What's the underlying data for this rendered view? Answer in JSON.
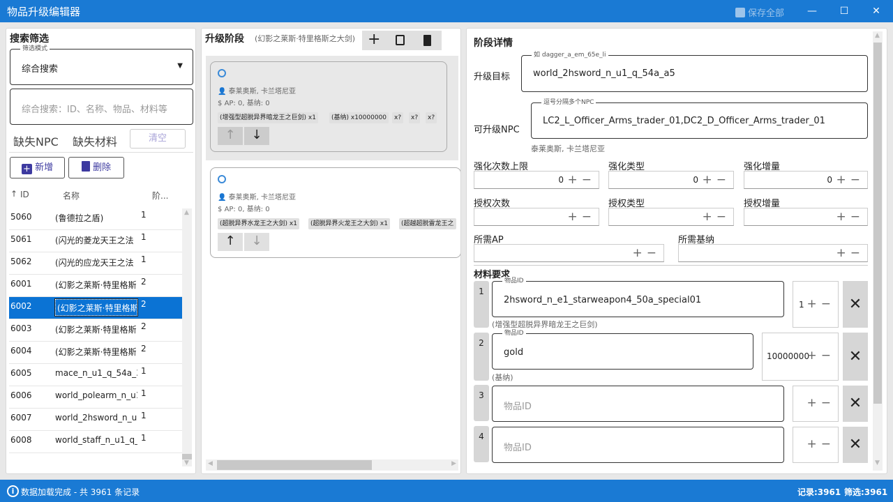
{
  "window": {
    "title": "物品升级编辑器",
    "save_all": "保存全部",
    "min": "—",
    "max": "☐",
    "close": "✕"
  },
  "left": {
    "title": "搜索筛选",
    "mode_legend": "筛选模式",
    "mode_value": "综合搜索",
    "search_placeholder": "综合搜索：ID、名称、物品、材料等",
    "missing_npc": "缺失NPC",
    "missing_material": "缺失材料",
    "clear": "清空",
    "add": "新增",
    "delete": "删除",
    "columns": {
      "id": "ID",
      "name": "名称",
      "stage": "阶..."
    },
    "rows": [
      {
        "id": "5060",
        "name": "(鲁德拉之盾)",
        "stage": "1"
      },
      {
        "id": "5061",
        "name": "(闪光的菱龙天王之法",
        "stage": "1"
      },
      {
        "id": "5062",
        "name": "(闪光的应龙天王之法",
        "stage": "1"
      },
      {
        "id": "6001",
        "name": "(幻影之莱斯·特里格斯",
        "stage": "2"
      },
      {
        "id": "6002",
        "name": "(幻影之莱斯·特里格斯",
        "stage": "2"
      },
      {
        "id": "6003",
        "name": "(幻影之莱斯·特里格斯",
        "stage": "2"
      },
      {
        "id": "6004",
        "name": "(幻影之莱斯·特里格斯",
        "stage": "2"
      },
      {
        "id": "6005",
        "name": "mace_n_u1_q_54a_3",
        "stage": "1"
      },
      {
        "id": "6006",
        "name": "world_polearm_n_u1",
        "stage": "1"
      },
      {
        "id": "6007",
        "name": "world_2hsword_n_u1",
        "stage": "1"
      },
      {
        "id": "6008",
        "name": "world_staff_n_u1_q_5",
        "stage": "1"
      }
    ]
  },
  "mid": {
    "title": "升级阶段",
    "subtitle": "(幻影之莱斯·特里格斯之大剑)",
    "stages": [
      {
        "npc": "泰莱奥斯, 卡兰塔尼亚",
        "ap": "AP: 0,  基纳: 0",
        "chips": [
          "(增强型超脱异界暗龙王之巨剑) x1",
          "(基纳) x10000000",
          "x?",
          "x?",
          "x?"
        ]
      },
      {
        "npc": "泰莱奥斯, 卡兰塔尼亚",
        "ap": "AP: 0,  基纳: 0",
        "chips": [
          "(超脱异界水龙王之大剑) x1",
          "(超脱异界火龙王之大剑) x1",
          "(超越超脱雷龙王之"
        ]
      }
    ]
  },
  "right": {
    "title": "阶段详情",
    "target_label": "升级目标",
    "target_legend": "如 dagger_a_em_65e_li",
    "target_value": "world_2hsword_n_u1_q_54a_a5",
    "npc_label": "可升级NPC",
    "npc_legend": "逗号分隔多个NPC",
    "npc_value": "LC2_L_Officer_Arms_trader_01,DC2_D_Officer_Arms_trader_01",
    "npc_names": "泰莱奥斯, 卡兰塔尼亚",
    "f_enh_max": "强化次数上限",
    "v_enh_max": "0",
    "f_enh_type": "强化类型",
    "v_enh_type": "0",
    "f_enh_inc": "强化增量",
    "v_enh_inc": "0",
    "f_auth": "授权次数",
    "f_auth_type": "授权类型",
    "f_auth_inc": "授权增量",
    "f_ap": "所需AP",
    "f_kinah": "所需基纳",
    "materials_title": "材料要求",
    "item_legend": "物品ID",
    "item_placeholder": "物品ID",
    "materials": [
      {
        "idx": "1",
        "id": "2hsword_n_e1_starweapon4_50a_special01",
        "qty": "1",
        "name": "(增强型超脱异界暗龙王之巨剑)"
      },
      {
        "idx": "2",
        "id": "gold",
        "qty": "10000000",
        "name": "(基纳)"
      },
      {
        "idx": "3",
        "id": "",
        "qty": "",
        "name": ""
      },
      {
        "idx": "4",
        "id": "",
        "qty": "",
        "name": ""
      }
    ]
  },
  "status": {
    "message": "数据加载完成 - 共 3961 条记录",
    "records": "记录:3961",
    "filtered": "筛选:3961"
  }
}
